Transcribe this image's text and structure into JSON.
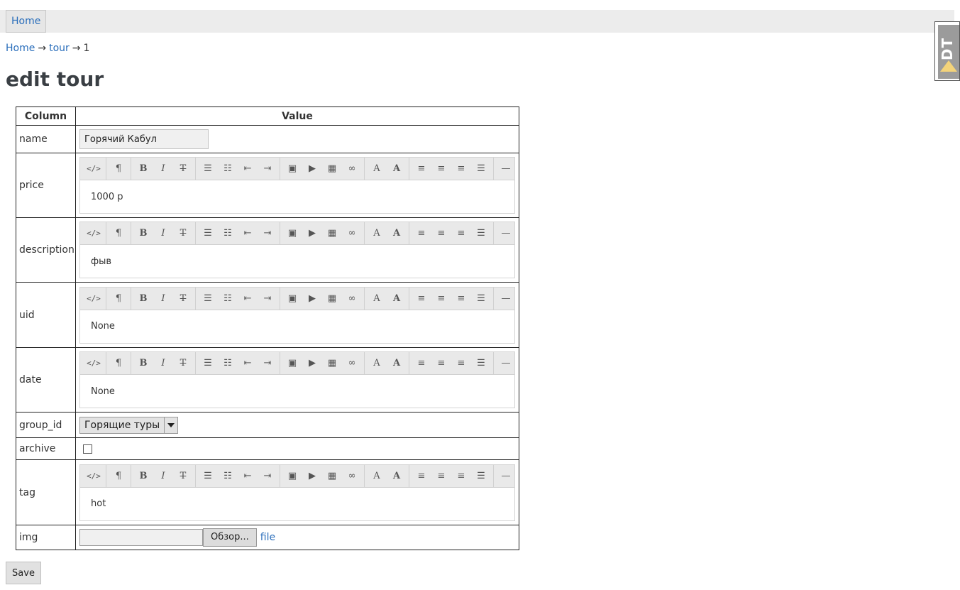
{
  "nav": {
    "home_label": "Home"
  },
  "debug_toolbar": {
    "label": "DT"
  },
  "breadcrumb": {
    "items": [
      "Home",
      "tour",
      "1"
    ],
    "separator": "→"
  },
  "page_title": "edit tour",
  "table": {
    "headers": {
      "column": "Column",
      "value": "Value"
    },
    "rows": {
      "name": {
        "label": "name",
        "value": "Горячий Кабул"
      },
      "price": {
        "label": "price",
        "value": "1000 р"
      },
      "description": {
        "label": "description",
        "value": "фыв"
      },
      "uid": {
        "label": "uid",
        "value": "None"
      },
      "date": {
        "label": "date",
        "value": "None"
      },
      "group_id": {
        "label": "group_id",
        "value": "Горящие туры"
      },
      "archive": {
        "label": "archive",
        "checked": false
      },
      "tag": {
        "label": "tag",
        "value": "hot"
      },
      "img": {
        "label": "img",
        "browse_label": "Обзор...",
        "link_label": "file"
      }
    }
  },
  "editor_toolbar_icons": [
    "html-icon",
    "paragraph-icon",
    "bold-icon",
    "italic-icon",
    "strikethrough-icon",
    "unordered-list-icon",
    "ordered-list-icon",
    "outdent-icon",
    "indent-icon",
    "image-icon",
    "video-icon",
    "table-icon",
    "link-icon",
    "font-color-icon",
    "background-color-icon",
    "align-left-icon",
    "align-center-icon",
    "align-right-icon",
    "justify-icon",
    "horizontal-rule-icon"
  ],
  "save_label": "Save",
  "colors": {
    "link": "#2a6ebb",
    "toolbar_bg": "#e9e9e9",
    "header_bar": "#ececec"
  }
}
